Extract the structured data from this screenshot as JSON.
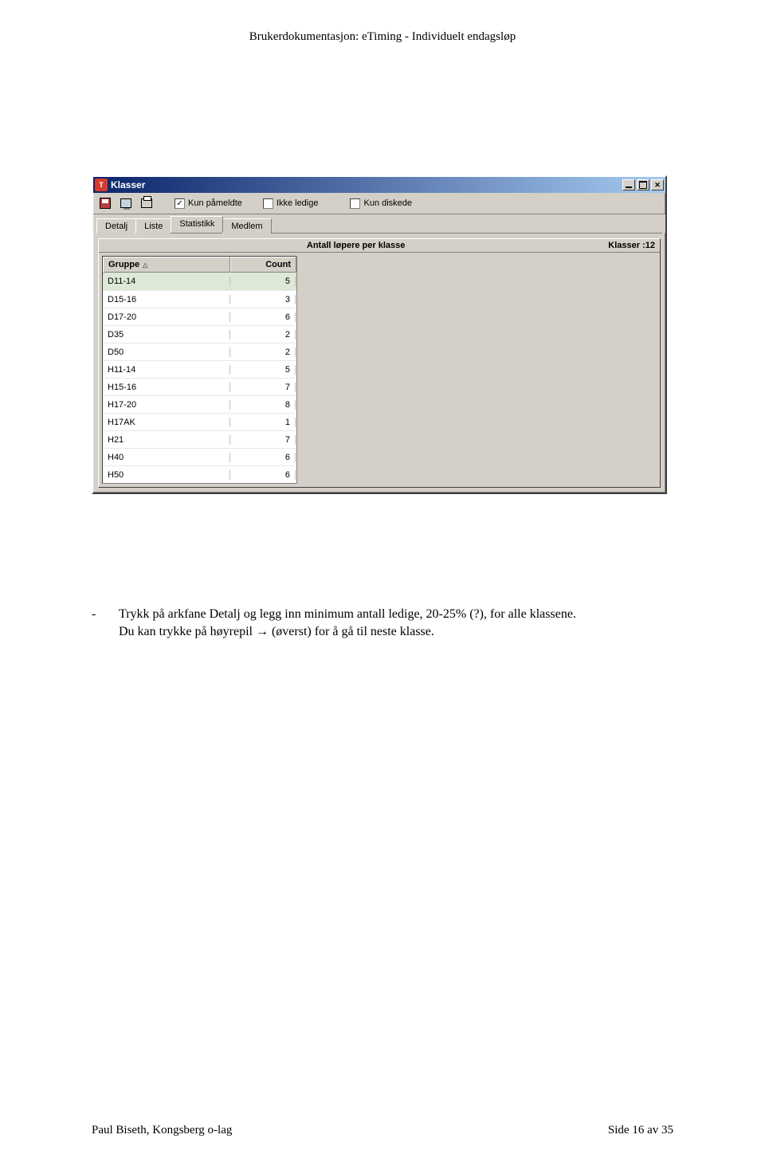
{
  "doc": {
    "header": "Brukerdokumentasjon: eTiming - Individuelt endagsløp",
    "footer_left": "Paul Biseth, Kongsberg o-lag",
    "footer_right": "Side 16 av 35",
    "bullet_dash": "-",
    "body_line1": "Trykk på arkfane Detalj og legg inn minimum antall ledige, 20-25% (?), for alle klassene.",
    "body_line2a": "Du kan trykke på høyrepil ",
    "body_arrow": "→",
    "body_line2b": " (øverst) for å gå til neste klasse."
  },
  "win": {
    "title": "Klasser",
    "checkboxes": {
      "kun_pameldte": {
        "label": "Kun påmeldte",
        "checked": true
      },
      "ikke_ledige": {
        "label": "Ikke ledige",
        "checked": false
      },
      "kun_diskede": {
        "label": "Kun diskede",
        "checked": false
      }
    },
    "tabs": [
      "Detalj",
      "Liste",
      "Statistikk",
      "Medlem"
    ],
    "active_tab_index": 2,
    "panel_title": "Antall løpere per klasse",
    "klasser_label": "Klasser :",
    "klasser_count": "12",
    "columns": {
      "group": "Gruppe",
      "count": "Count"
    },
    "rows": [
      {
        "group": "D11-14",
        "count": "5"
      },
      {
        "group": "D15-16",
        "count": "3"
      },
      {
        "group": "D17-20",
        "count": "6"
      },
      {
        "group": "D35",
        "count": "2"
      },
      {
        "group": "D50",
        "count": "2"
      },
      {
        "group": "H11-14",
        "count": "5"
      },
      {
        "group": "H15-16",
        "count": "7"
      },
      {
        "group": "H17-20",
        "count": "8"
      },
      {
        "group": "H17AK",
        "count": "1"
      },
      {
        "group": "H21",
        "count": "7"
      },
      {
        "group": "H40",
        "count": "6"
      },
      {
        "group": "H50",
        "count": "6"
      }
    ]
  }
}
